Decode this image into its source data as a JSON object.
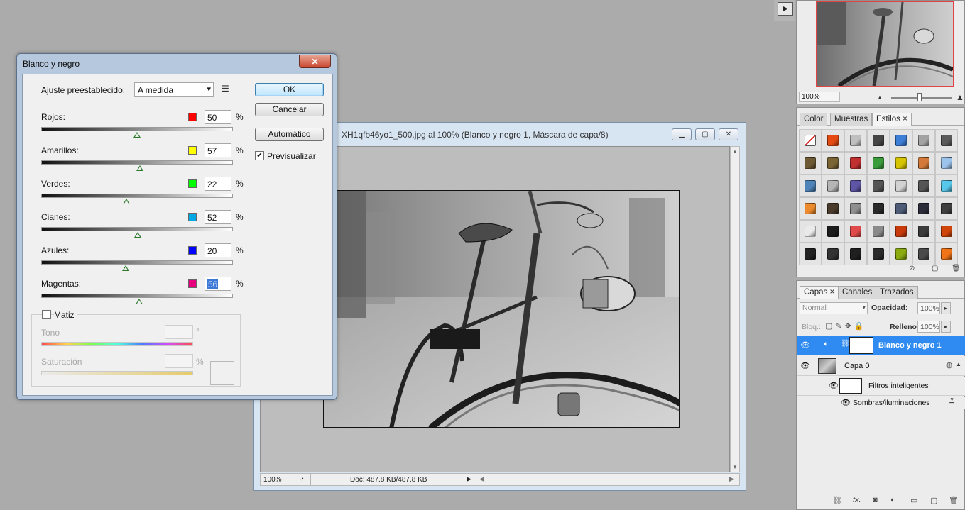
{
  "navigator": {
    "zoom": "100%"
  },
  "styles_panel": {
    "tabs": [
      "Color",
      "Muestras",
      "Estilos"
    ],
    "active_tab": "Estilos",
    "swatch_colors": [
      "#ffffff",
      "#e44a12",
      "#bfbfbf",
      "#454545",
      "#3d7fd6",
      "#a3a3a3",
      "#5a5a5a",
      "#6e5a35",
      "#7a6433",
      "#c03030",
      "#3a9b3a",
      "#d6c400",
      "#d37a3a",
      "#9cc3ec",
      "#4f84b8",
      "#b5b5b5",
      "#5f55a5",
      "#555555",
      "#d2d2d2",
      "#555555",
      "#58c8ea",
      "#ec8a2d",
      "#4a3b2c",
      "#8f8f8f",
      "#2a2a2a",
      "#4e5c78",
      "#2c2c3a",
      "#3f3f3f",
      "#eaeaea",
      "#1c1c1c",
      "#e04a4a",
      "#8a8a8a",
      "#c83a0a",
      "#3a3a3a",
      "#d0450a",
      "#222222",
      "#333333",
      "#1f1f1f",
      "#2a2a2a",
      "#8aaa10",
      "#4a4a4a",
      "#f07418"
    ]
  },
  "layers_panel": {
    "tabs": [
      "Capas",
      "Canales",
      "Trazados"
    ],
    "active_tab": "Capas",
    "blend_mode": "Normal",
    "opacity_label": "Opacidad:",
    "opacity": "100%",
    "lock_label": "Bloq.:",
    "fill_label": "Relleno:",
    "fill": "100%",
    "layers": [
      {
        "name": "Blanco y negro 1"
      },
      {
        "name": "Capa 0"
      },
      {
        "name": "Filtros inteligentes"
      },
      {
        "name": "Sombras/iluminaciones"
      }
    ]
  },
  "document": {
    "title": "XH1qfb46yo1_500.jpg al 100% (Blanco y negro 1, Máscara de capa/8)",
    "zoom": "100%",
    "doc_info": "Doc: 487.8 KB/487.8 KB"
  },
  "dialog": {
    "title": "Blanco y negro",
    "preset_label": "Ajuste preestablecido:",
    "preset_value": "A medida",
    "ok_label": "OK",
    "cancel_label": "Cancelar",
    "auto_label": "Automático",
    "preview_label": "Previsualizar",
    "preview_checked": true,
    "percent_sign": "%",
    "sliders": [
      {
        "label": "Rojos:",
        "value": "50",
        "color": "#ff0000"
      },
      {
        "label": "Amarillos:",
        "value": "57",
        "color": "#ffff00"
      },
      {
        "label": "Verdes:",
        "value": "22",
        "color": "#00ff00"
      },
      {
        "label": "Cianes:",
        "value": "52",
        "color": "#00a8e6"
      },
      {
        "label": "Azules:",
        "value": "20",
        "color": "#0000ff"
      },
      {
        "label": "Magentas:",
        "value": "56",
        "color": "#e6007e"
      }
    ],
    "tint": {
      "label": "Matiz",
      "checked": false,
      "hue_label": "Tono",
      "hue_unit": "°",
      "saturation_label": "Saturación",
      "saturation_unit": "%"
    }
  }
}
